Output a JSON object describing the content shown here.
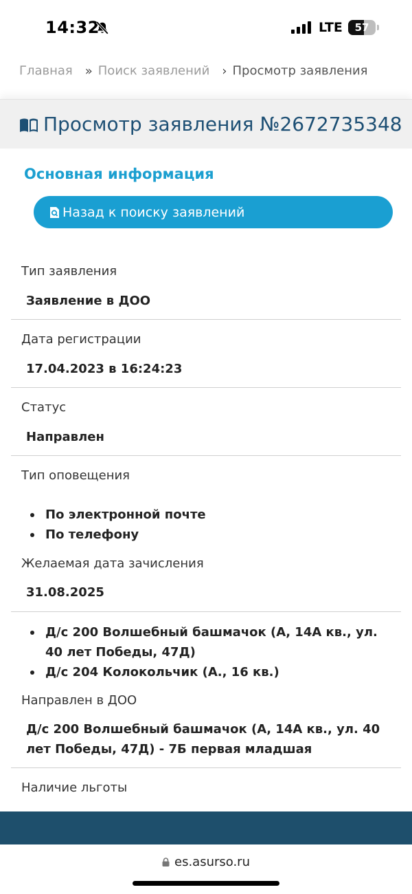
{
  "status_bar": {
    "time": "14:32",
    "network": "LTE",
    "battery_level": "57",
    "battery_fraction": 0.57
  },
  "icons": {
    "bell": "bell-slash-icon",
    "signal": "signal-icon",
    "book": "open-book-icon",
    "search_doc": "search-document-icon",
    "lock": "lock-icon"
  },
  "breadcrumb": {
    "home": "Главная",
    "sep1": "»",
    "search": "Поиск заявлений",
    "sep2": "›",
    "current": "Просмотр заявления"
  },
  "page": {
    "title": "Просмотр заявления №2672735348",
    "section_heading": "Основная информация",
    "back_button": "Назад к поиску заявлений"
  },
  "fields": {
    "type_label": "Тип заявления",
    "type_value": "Заявление в ДОО",
    "reg_date_label": "Дата регистрации",
    "reg_date_value": "17.04.2023 в 16:24:23",
    "status_label": "Статус",
    "status_value": "Направлен",
    "notify_label": "Тип оповещения",
    "notify_items": [
      "По электронной почте",
      "По телефону"
    ],
    "desired_date_label": "Желаемая дата зачисления",
    "desired_date_value": "31.08.2025",
    "preferred_doo": [
      "Д/с 200 Волшебный башмачок (А, 14А кв., ул. 40 лет Победы, 47Д)",
      "Д/с 204 Колокольчик (А., 16 кв.)"
    ],
    "directed_label": "Направлен в ДОО",
    "directed_value": "Д/с 200 Волшебный башмачок (А, 14А кв., ул. 40 лет Победы, 47Д) - 7Б первая младшая",
    "benefit_label": "Наличие льготы"
  },
  "browser": {
    "url": "es.asurso.ru"
  },
  "colors": {
    "accent": "#1a9fd2",
    "title": "#1d4f74",
    "footer": "#1e4f6c"
  }
}
